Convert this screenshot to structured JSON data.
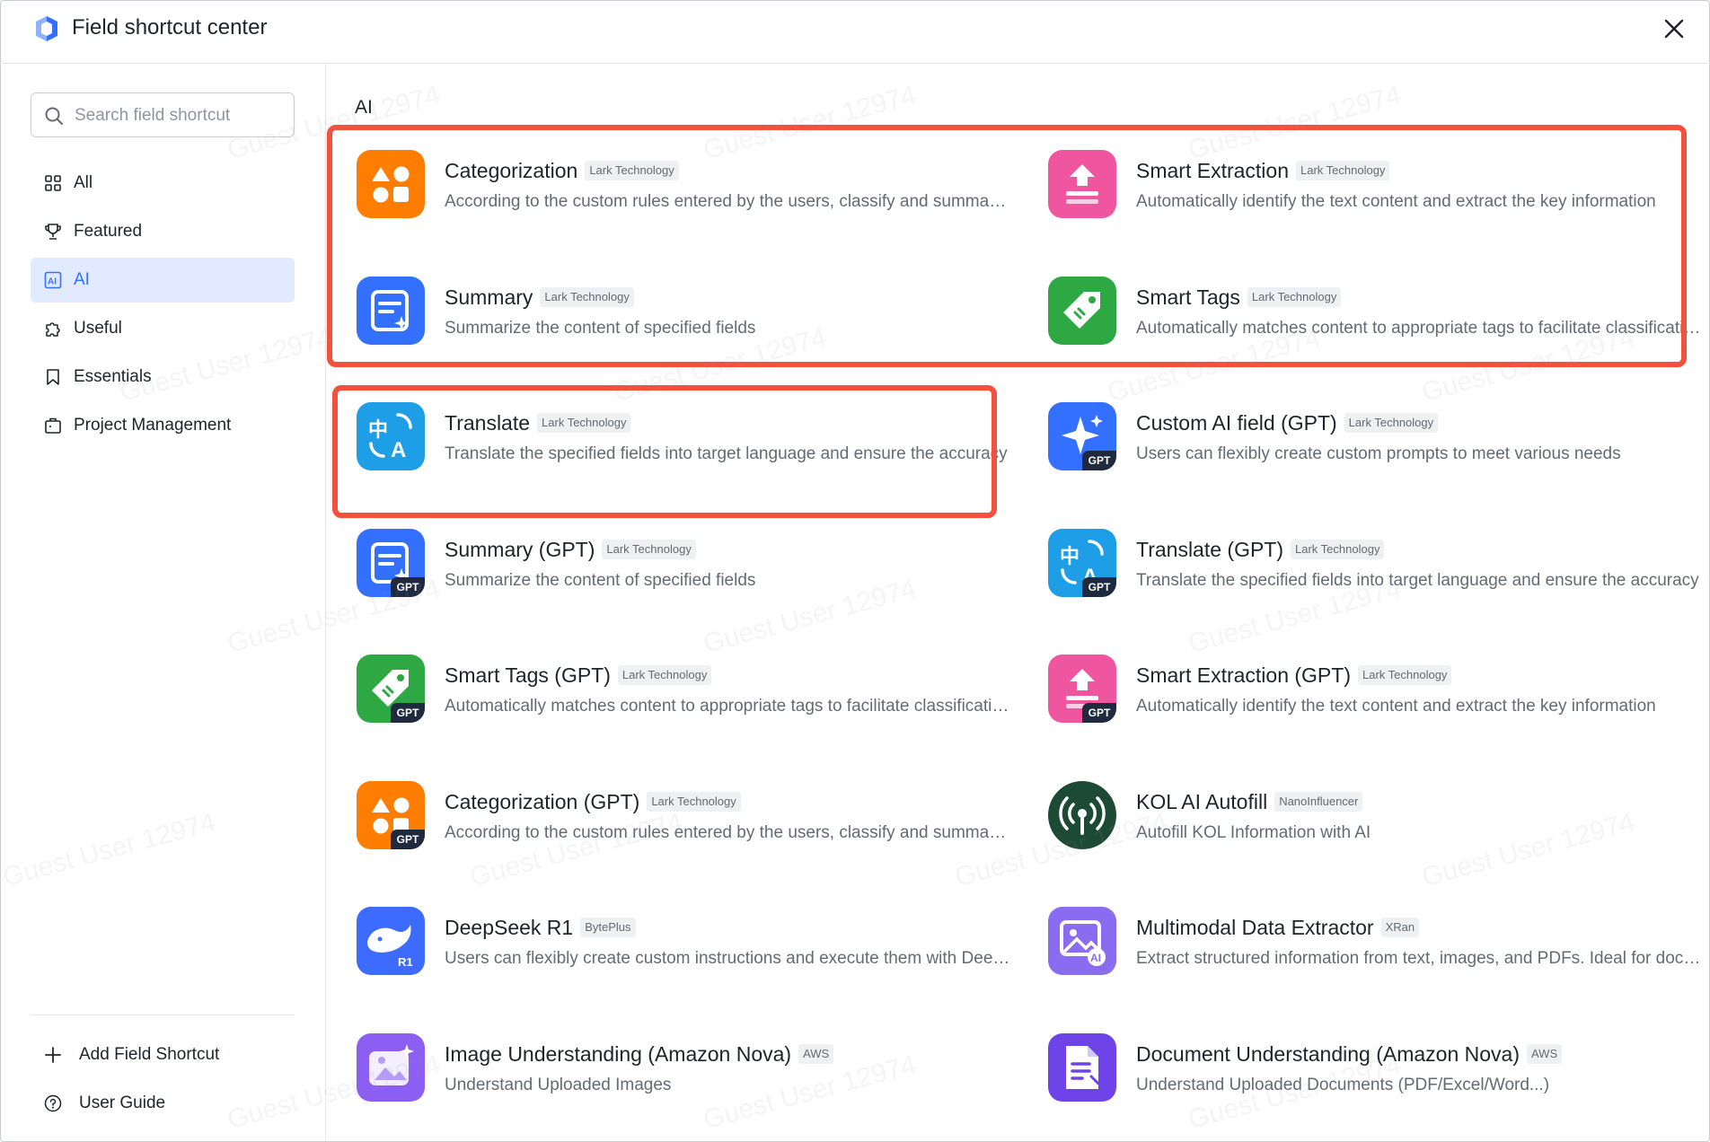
{
  "window": {
    "title": "Field shortcut center"
  },
  "search": {
    "placeholder": "Search field shortcut",
    "value": ""
  },
  "sidebar": {
    "items": [
      {
        "label": "All",
        "icon": "grid-icon",
        "active": false
      },
      {
        "label": "Featured",
        "icon": "trophy-icon",
        "active": false
      },
      {
        "label": "AI",
        "icon": "ai-icon",
        "active": true
      },
      {
        "label": "Useful",
        "icon": "puzzle-icon",
        "active": false
      },
      {
        "label": "Essentials",
        "icon": "bookmark-icon",
        "active": false
      },
      {
        "label": "Project Management",
        "icon": "briefcase-icon",
        "active": false
      }
    ],
    "footer": [
      {
        "label": "Add Field Shortcut",
        "icon": "plus-icon"
      },
      {
        "label": "User Guide",
        "icon": "help-circle-icon"
      }
    ]
  },
  "section": {
    "title": "AI"
  },
  "cards": [
    {
      "name": "Categorization",
      "tag": "Lark Technology",
      "desc": "According to the custom rules entered by the users, classify and summarize the content",
      "icon": "categorization-icon",
      "color": "#ff7d00",
      "gpt": false
    },
    {
      "name": "Smart Extraction",
      "tag": "Lark Technology",
      "desc": "Automatically identify the text content and extract the key information",
      "icon": "extraction-icon",
      "color": "#f0569f",
      "gpt": false
    },
    {
      "name": "Summary",
      "tag": "Lark Technology",
      "desc": "Summarize the content of specified fields",
      "icon": "summary-icon",
      "color": "#3370ff",
      "gpt": false
    },
    {
      "name": "Smart Tags",
      "tag": "Lark Technology",
      "desc": "Automatically matches content to appropriate tags to facilitate classification",
      "icon": "tag-icon",
      "color": "#2ea843",
      "gpt": false
    },
    {
      "name": "Translate",
      "tag": "Lark Technology",
      "desc": "Translate the specified fields into target language and ensure the accuracy",
      "icon": "translate-icon",
      "color": "#1e9ee6",
      "gpt": false
    },
    {
      "name": "Custom AI field (GPT)",
      "tag": "Lark Technology",
      "desc": "Users can flexibly create custom prompts to meet various needs",
      "icon": "sparkle-icon",
      "color": "#3370ff",
      "gpt": true
    },
    {
      "name": "Summary (GPT)",
      "tag": "Lark Technology",
      "desc": "Summarize the content of specified fields",
      "icon": "summary-icon",
      "color": "#3370ff",
      "gpt": true
    },
    {
      "name": "Translate (GPT)",
      "tag": "Lark Technology",
      "desc": "Translate the specified fields into target language and ensure the accuracy",
      "icon": "translate-icon",
      "color": "#1e9ee6",
      "gpt": true
    },
    {
      "name": "Smart Tags (GPT)",
      "tag": "Lark Technology",
      "desc": "Automatically matches content to appropriate tags to facilitate classification",
      "icon": "tag-icon",
      "color": "#2ea843",
      "gpt": true
    },
    {
      "name": "Smart Extraction (GPT)",
      "tag": "Lark Technology",
      "desc": "Automatically identify the text content and extract the key information",
      "icon": "extraction-icon",
      "color": "#f0569f",
      "gpt": true
    },
    {
      "name": "Categorization (GPT)",
      "tag": "Lark Technology",
      "desc": "According to the custom rules entered by the users, classify and summarize the content",
      "icon": "categorization-icon",
      "color": "#ff7d00",
      "gpt": true
    },
    {
      "name": "KOL AI Autofill",
      "tag": "NanoInfluencer",
      "desc": "Autofill KOL Information with AI",
      "icon": "broadcast-icon",
      "color": "#1d4a35",
      "gpt": false
    },
    {
      "name": "DeepSeek R1",
      "tag": "BytePlus",
      "desc": "Users can flexibly create custom instructions and execute them with DeepSeek",
      "icon": "whale-icon",
      "color": "#3d6bff",
      "gpt": false
    },
    {
      "name": "Multimodal Data Extractor",
      "tag": "XRan",
      "desc": "Extract structured information from text, images, and PDFs. Ideal for documents",
      "icon": "image-ai-icon",
      "color": "#8a6cf0",
      "gpt": false
    },
    {
      "name": "Image Understanding (Amazon Nova)",
      "tag": "AWS",
      "desc": "Understand Uploaded Images",
      "icon": "image-sparkle-icon",
      "color": "#8d5ef2",
      "gpt": false
    },
    {
      "name": "Document Understanding (Amazon Nova)",
      "tag": "AWS",
      "desc": "Understand Uploaded Documents (PDF/Excel/Word...)",
      "icon": "document-icon",
      "color": "#6e44e8",
      "gpt": false
    }
  ],
  "gpt_badge": "GPT",
  "r1_badge": "R1",
  "watermark": "Guest User 12974",
  "colors": {
    "accent": "#3370ff",
    "highlight": "#f5503c",
    "active_bg": "#e1eaff"
  }
}
